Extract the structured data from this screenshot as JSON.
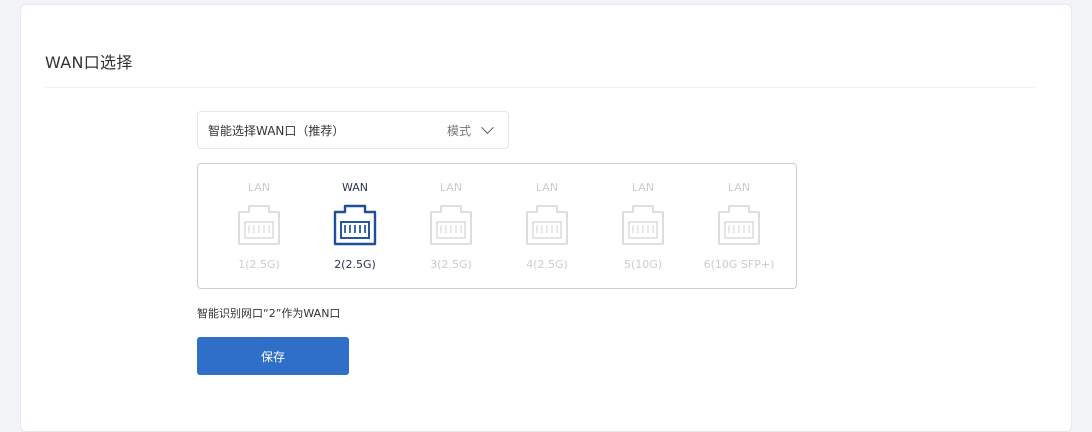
{
  "section": {
    "title": "WAN口选择"
  },
  "mode_select": {
    "value": "智能选择WAN口（推荐）",
    "suffix": "模式"
  },
  "ports": [
    {
      "type": "LAN",
      "name": "1(2.5G)",
      "active": false
    },
    {
      "type": "WAN",
      "name": "2(2.5G)",
      "active": true
    },
    {
      "type": "LAN",
      "name": "3(2.5G)",
      "active": false
    },
    {
      "type": "LAN",
      "name": "4(2.5G)",
      "active": false
    },
    {
      "type": "LAN",
      "name": "5(10G)",
      "active": false
    },
    {
      "type": "LAN",
      "name": "6(10G SFP+)",
      "active": false
    }
  ],
  "hint": "智能识别网口“2”作为WAN口",
  "save_label": "保存",
  "colors": {
    "accent": "#2f6fc8",
    "active_port": "#1f4f9a",
    "inactive_port": "#d2d6dc"
  }
}
